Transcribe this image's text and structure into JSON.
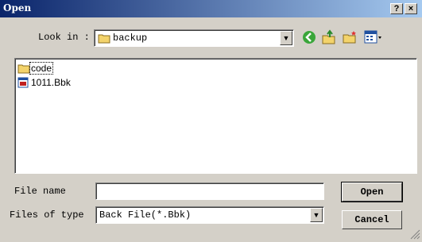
{
  "window": {
    "title": "Open",
    "help_button": "?",
    "close_button": "×"
  },
  "look_in": {
    "label": "Look in :",
    "value": "backup"
  },
  "files": [
    {
      "name": "code",
      "type": "folder"
    },
    {
      "name": "1011.Bbk",
      "type": "file"
    }
  ],
  "file_name": {
    "label": "File name",
    "value": ""
  },
  "files_of_type": {
    "label": "Files of type",
    "value": "Back File(*.Bbk)"
  },
  "buttons": {
    "open": "Open",
    "cancel": "Cancel"
  }
}
